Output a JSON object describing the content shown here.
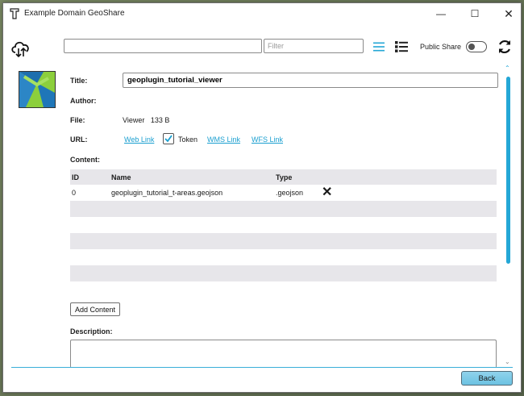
{
  "window": {
    "title": "Example Domain GeoShare"
  },
  "toolbar": {
    "search_value": "",
    "filter_placeholder": "Filter",
    "public_share_label": "Public Share",
    "public_share_on": false
  },
  "form": {
    "title_label": "Title:",
    "title_value": "geoplugin_tutorial_viewer",
    "author_label": "Author:",
    "author_value": "",
    "file_label": "File:",
    "file_value": "Viewer   133 B",
    "url_label": "URL:",
    "web_link": "Web Link",
    "token_label": "Token",
    "token_checked": true,
    "wms_link": "WMS Link",
    "wfs_link": "WFS Link",
    "content_label": "Content:",
    "description_label": "Description:",
    "description_value": ""
  },
  "content_table": {
    "headers": [
      "ID",
      "Name",
      "Type"
    ],
    "rows": [
      {
        "id": "0",
        "name": "geoplugin_tutorial_t-areas.geojson",
        "type": ".geojson",
        "delete": "✕"
      }
    ]
  },
  "buttons": {
    "add_content": "Add Content",
    "back": "Back"
  },
  "colors": {
    "accent": "#24a7d6",
    "back_button": "#7ccbe8",
    "row_alt": "#e7e6ea"
  }
}
